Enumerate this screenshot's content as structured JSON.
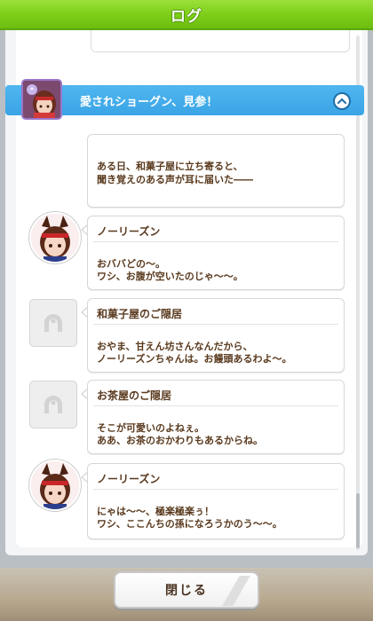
{
  "header": {
    "title": "ログ"
  },
  "chapter": {
    "title": "愛されショーグン、見参！"
  },
  "entries": [
    {
      "speaker": "",
      "lines": [
        "ある日、和菓子屋に立ち寄ると、",
        "聞き覚えのある声が耳に届いた――"
      ]
    },
    {
      "speaker": "ノーリーズン",
      "lines": [
        "おババどの～。",
        "ワシ、お腹が空いたのじゃ～～。"
      ]
    },
    {
      "speaker": "和菓子屋のご隠居",
      "lines": [
        "おやま、甘えん坊さんなんだから、",
        "ノーリーズンちゃんは。お饅頭あるわよ～。"
      ]
    },
    {
      "speaker": "お茶屋のご隠居",
      "lines": [
        "そこが可愛いのよねぇ。",
        "ああ、お茶のおかわりもあるからね。"
      ]
    },
    {
      "speaker": "ノーリーズン",
      "lines": [
        "にゃは～～、極楽極楽ぅ！",
        "ワシ、ここんちの孫になろうかのう～～。"
      ]
    }
  ],
  "close_button": {
    "label": "閉じる"
  },
  "icons": {
    "collapse": "chevron-up-icon",
    "placeholder": "horseshoe-icon"
  },
  "colors": {
    "header_green": "#7ccd17",
    "chapter_blue": "#3aa4e6",
    "text_brown": "#5a3a1e"
  }
}
